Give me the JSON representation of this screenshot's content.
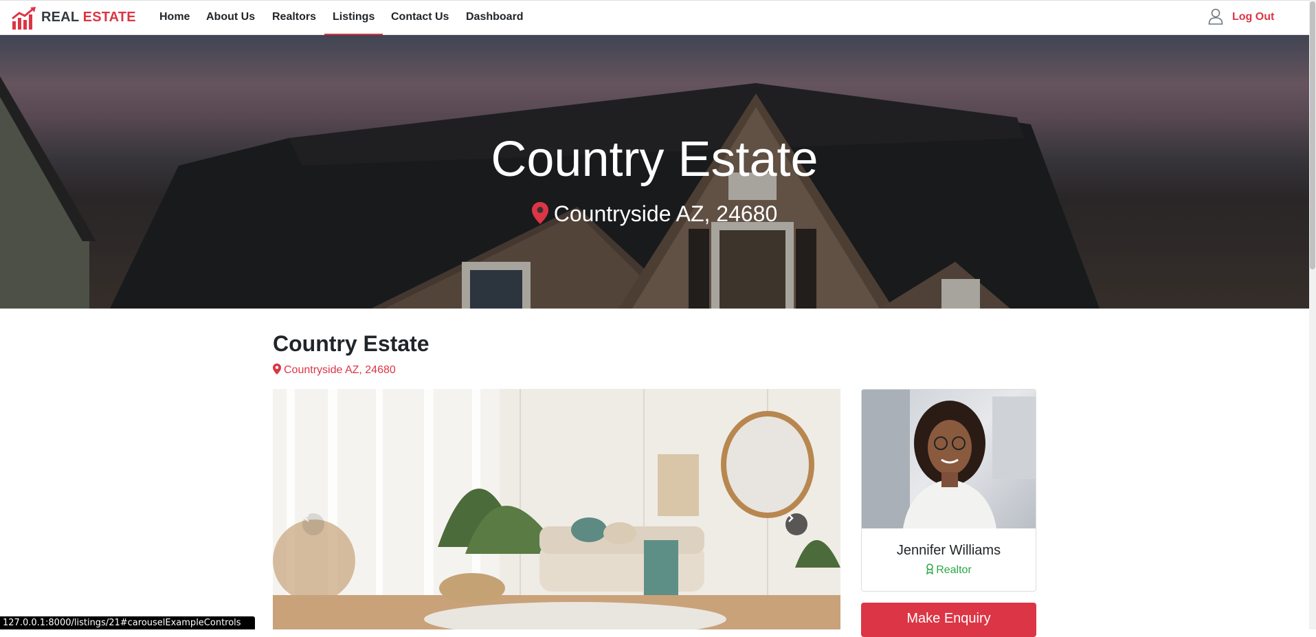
{
  "navbar": {
    "brand_part1": "REAL",
    "brand_part2": "ESTATE",
    "logo_icon": "chart-arrow-icon",
    "links": [
      {
        "label": "Home"
      },
      {
        "label": "About Us"
      },
      {
        "label": "Realtors"
      },
      {
        "label": "Listings",
        "active": true
      },
      {
        "label": "Contact Us"
      },
      {
        "label": "Dashboard"
      }
    ],
    "user_icon": "user-icon",
    "logout_label": "Log Out"
  },
  "hero": {
    "title": "Country Estate",
    "location": "Countryside AZ, 24680"
  },
  "listing": {
    "title": "Country Estate",
    "location": "Countryside AZ, 24680"
  },
  "carousel": {
    "prev_icon": "chevron-left-icon",
    "next_icon": "chevron-right-icon"
  },
  "realtor": {
    "name": "Jennifer Williams",
    "role": "Realtor",
    "role_icon": "award-icon"
  },
  "actions": {
    "enquiry_label": "Make Enquiry"
  },
  "status_bar": {
    "url": "127.0.0.1:8000/listings/21#carouselExampleControls"
  },
  "colors": {
    "accent": "#dc3545",
    "success": "#28a745"
  }
}
